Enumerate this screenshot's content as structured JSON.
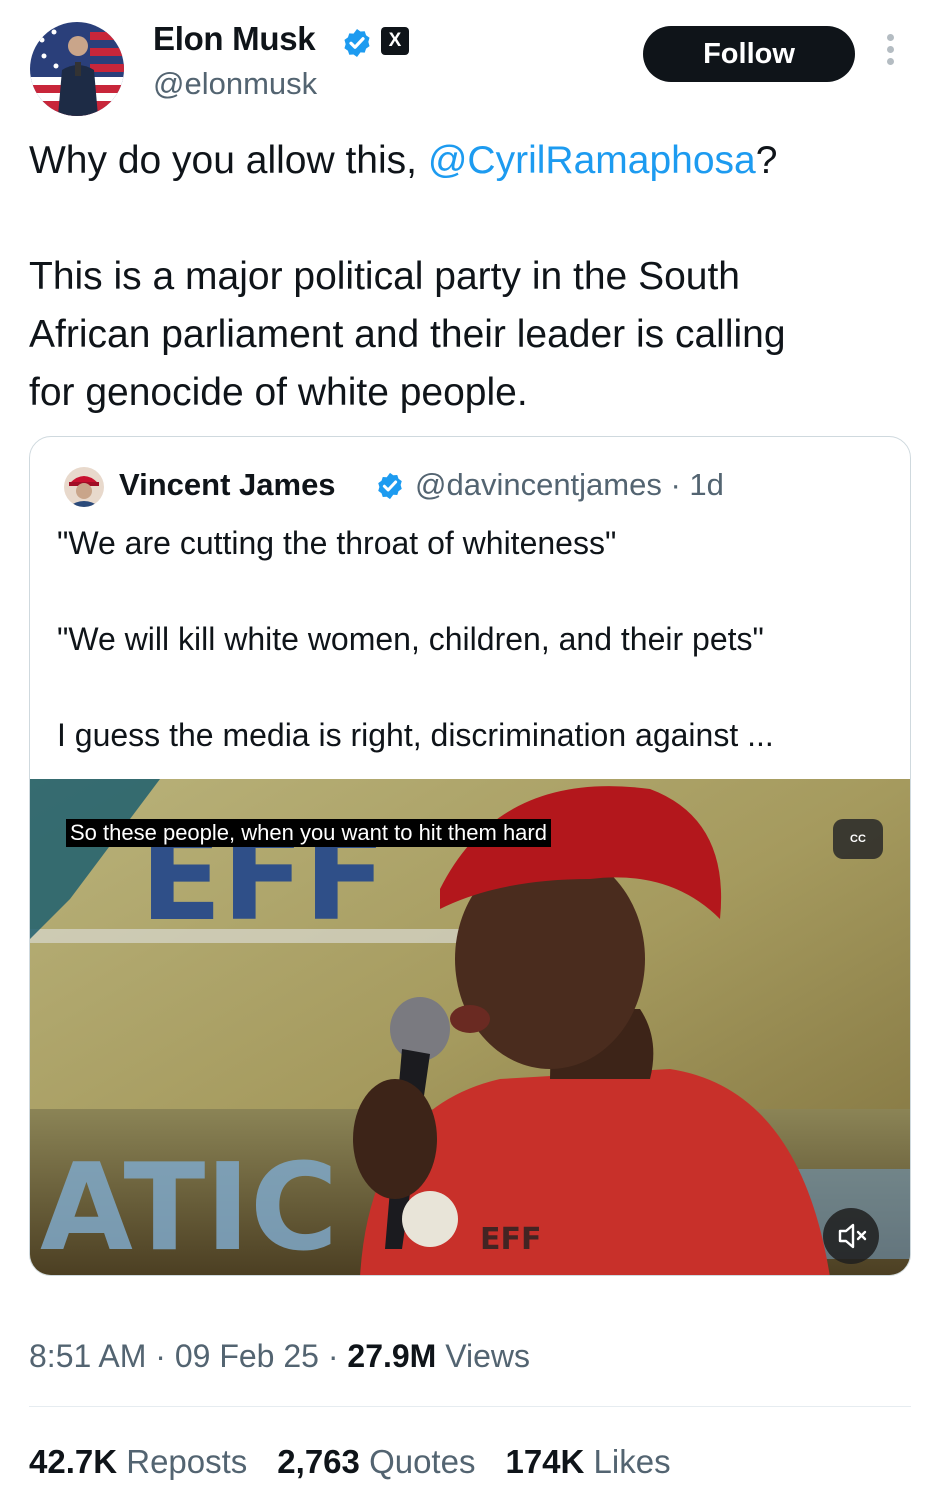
{
  "author": {
    "name": "Elon Musk",
    "handle": "@elonmusk",
    "x_badge": "X"
  },
  "follow_label": "Follow",
  "tweet": {
    "line1_prefix": "Why do you allow this, ",
    "line1_mention": "@CyrilRamaphosa",
    "line1_suffix": "?",
    "line2": "This is a major political party in the South",
    "line3": "African parliament and their leader is calling",
    "line4": "for genocide of white people."
  },
  "quote": {
    "name": "Vincent James",
    "meta": "@davincentjames · 1d",
    "line1": "\"We are cutting the throat of whiteness\"",
    "line2": "\"We will kill white women, children, and their pets\"",
    "line3": "I guess the media is right, discrimination against ...",
    "video": {
      "caption": "So these people, when you want to hit them hard",
      "cc_label": "CC",
      "scene_text_1": "EFF",
      "scene_text_2": "ATIC"
    }
  },
  "footer": {
    "time": "8:51 AM",
    "date": "09 Feb 25",
    "views_count": "27.9M",
    "views_label": "Views",
    "reposts_count": "42.7K",
    "reposts_label": "Reposts",
    "quotes_count": "2,763",
    "quotes_label": "Quotes",
    "likes_count": "174K",
    "likes_label": "Likes"
  },
  "colors": {
    "link": "#1d9bf0",
    "secondary_text": "#536471",
    "primary_text": "#0f1419",
    "verified": "#1d9bf0"
  },
  "icons": [
    "verified-icon",
    "x-logo-icon",
    "more-icon",
    "cc-icon",
    "mute-icon"
  ]
}
